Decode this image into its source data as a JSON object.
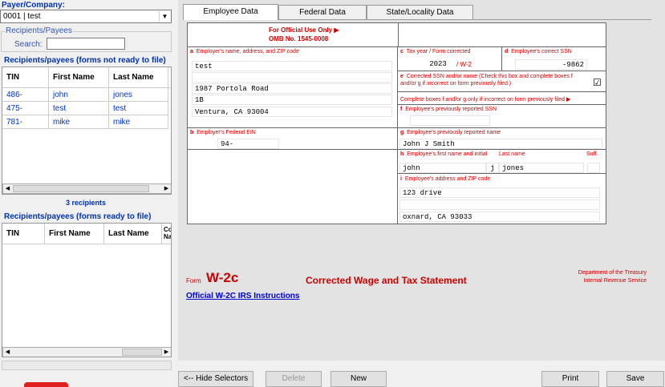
{
  "left": {
    "payer_label": "Payer/Company:",
    "payer_value": "0001 | test",
    "recip_group": "Recipients/Payees",
    "search_label": "Search:",
    "search_value": "",
    "not_ready_title": "Recipients/payees (forms not ready to file)",
    "not_ready_headers": [
      "TIN",
      "First Name",
      "Last Name"
    ],
    "not_ready_rows": [
      {
        "tin": "486-",
        "first": "john",
        "last": "jones"
      },
      {
        "tin": "475-",
        "first": "test",
        "last": "test"
      },
      {
        "tin": "781-",
        "first": "mike",
        "last": "mike"
      }
    ],
    "count": "3 recipients",
    "ready_title": "Recipients/payees (forms ready to file)",
    "ready_headers": [
      "TIN",
      "First Name",
      "Last Name",
      "Co Na"
    ]
  },
  "tabs": [
    "Employee Data",
    "Federal Data",
    "State/Locality Data"
  ],
  "form": {
    "official_use": "For Official Use Only ▶",
    "omb": "OMB No. 1545-0008",
    "a_letter": "a",
    "a_label": "Employer's name, address, and ZIP code",
    "a_lines": [
      "test",
      "",
      "1987 Portola Road",
      "1B",
      "Ventura, CA 93004"
    ],
    "c_letter": "c",
    "c_label": "Tax year / Form corrected",
    "tax_year": "2023",
    "form_corrected": "/ W-2",
    "d_letter": "d",
    "d_label": "Employee's correct SSN",
    "ssn": "-9862",
    "e_letter": "e",
    "e_label": "Corrected SSN and/or name (Check this box and complete boxes f and/or g if incorrect on form previously filed.)",
    "e_checked": "☑",
    "complete_note": "Complete boxes f and/or g only if incorrect on form previously filed ▶",
    "f_letter": "f",
    "f_label": "Employee's previously reported SSN",
    "b_letter": "b",
    "b_label": "Employer's Federal EIN",
    "ein": "94-",
    "g_letter": "g",
    "g_label": "Employee's previously reported name",
    "prev_name": "John J Smith",
    "h_letter": "h",
    "h_label": "Employee's first name and initial",
    "h_last": "Last name",
    "h_suff": "Suff.",
    "first": "john",
    "initial": "j",
    "last": "jones",
    "suff": "",
    "i_letter": "i",
    "i_label": "Employee's address and ZIP code",
    "addr_lines": [
      "123 drive",
      "",
      "oxnard, CA 93033"
    ]
  },
  "footer": {
    "form_word": "Form",
    "form_name": "W-2c",
    "title": "Corrected Wage and Tax Statement",
    "dept": "Department of the Treasury",
    "irs": "Internal Revenue Service",
    "link": "Official W-2C  IRS Instructions"
  },
  "buttons": {
    "hide": "<-- Hide Selectors",
    "delete": "Delete",
    "new": "New",
    "print": "Print",
    "save": "Save"
  }
}
